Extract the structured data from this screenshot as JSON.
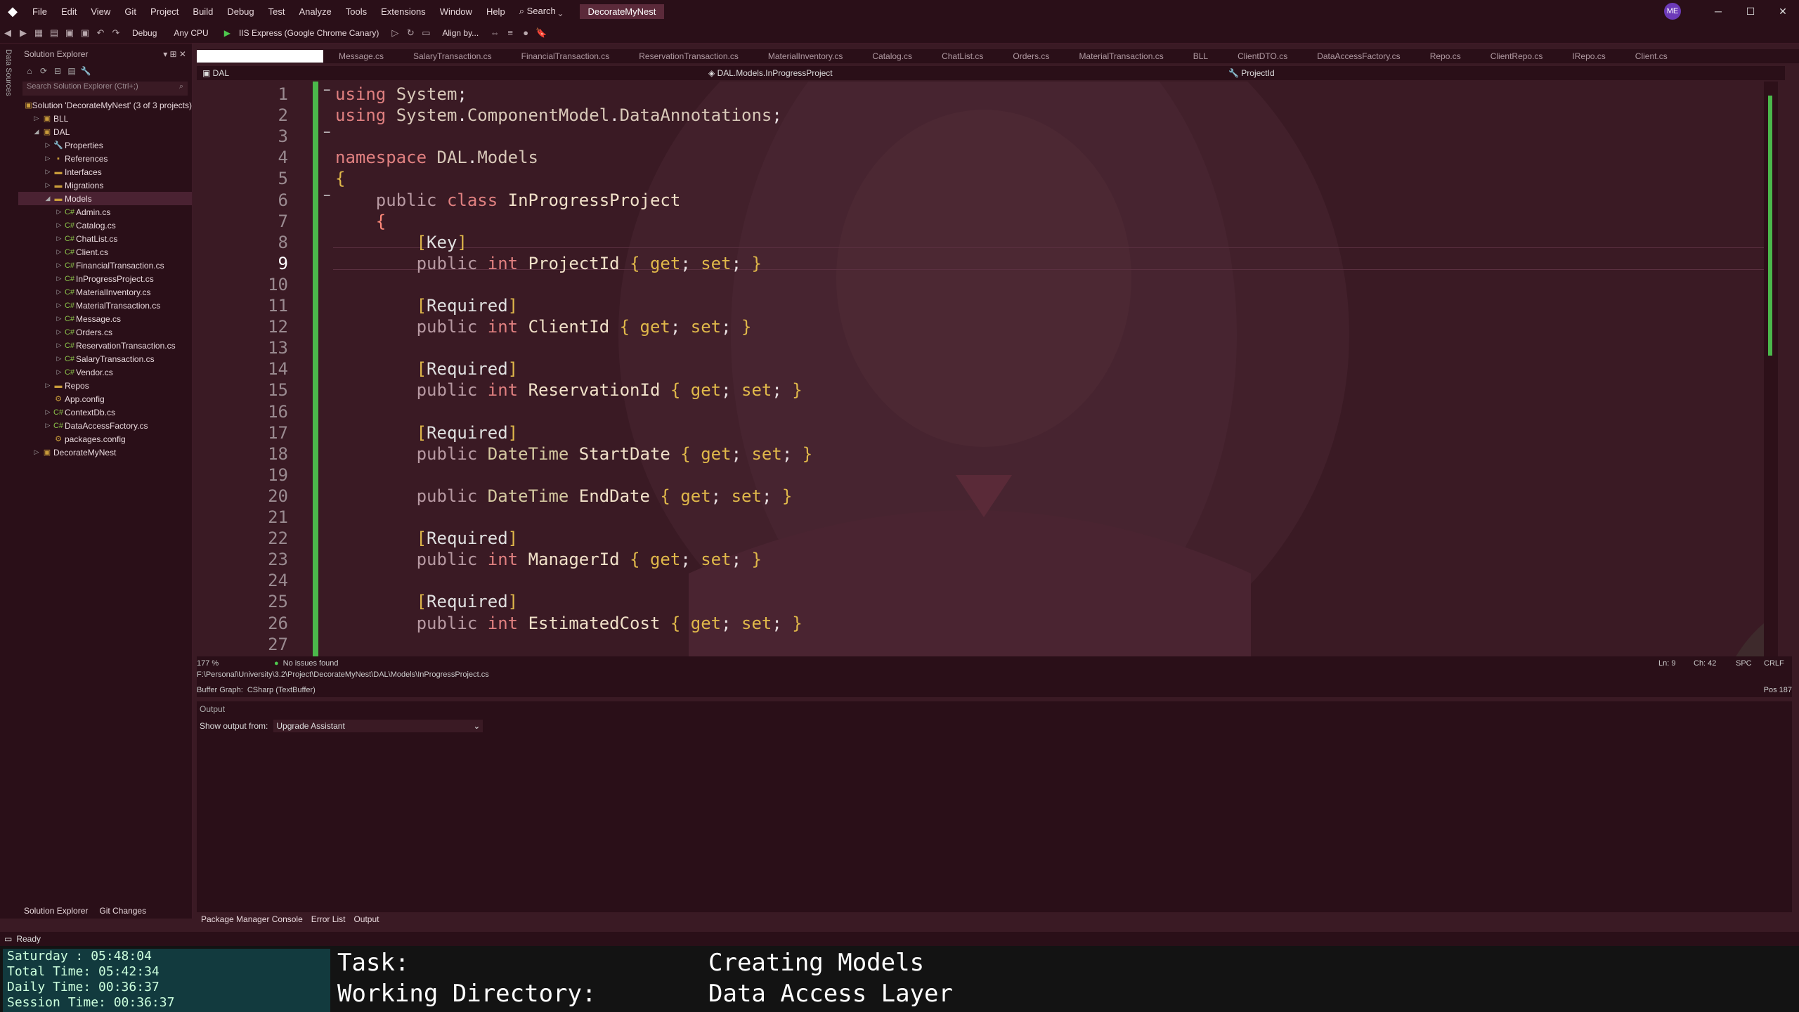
{
  "titlebar": {
    "menu": [
      "File",
      "Edit",
      "View",
      "Git",
      "Project",
      "Build",
      "Debug",
      "Test",
      "Analyze",
      "Tools",
      "Extensions",
      "Window",
      "Help"
    ],
    "search_label": "Search",
    "solution_name": "DecorateMyNest",
    "user_initials": "ME",
    "minimize": "─",
    "maximize": "☐",
    "close": "✕"
  },
  "toolbar": {
    "config": "Debug",
    "platform": "Any CPU",
    "run_target": "IIS Express (Google Chrome Canary)",
    "align_label": "Align by..."
  },
  "left_strip": {
    "label": "Data Sources"
  },
  "solution_explorer": {
    "title": "Solution Explorer",
    "search_placeholder": "Search Solution Explorer (Ctrl+;)",
    "items": [
      {
        "label": "Solution 'DecorateMyNest' (3 of 3 projects)",
        "indent": 0,
        "expander": "",
        "icon": "solution-icon",
        "glyph": "▣",
        "cs": false,
        "selected": false
      },
      {
        "label": "BLL",
        "indent": 1,
        "expander": "▷",
        "icon": "project-icon",
        "glyph": "▣",
        "cs": false,
        "selected": false
      },
      {
        "label": "DAL",
        "indent": 1,
        "expander": "◢",
        "icon": "project-icon",
        "glyph": "▣",
        "cs": false,
        "selected": false
      },
      {
        "label": "Properties",
        "indent": 2,
        "expander": "▷",
        "icon": "wrench-icon",
        "glyph": "🔧",
        "cs": false,
        "selected": false
      },
      {
        "label": "References",
        "indent": 2,
        "expander": "▷",
        "icon": "references-icon",
        "glyph": "▪",
        "cs": false,
        "selected": false
      },
      {
        "label": "Interfaces",
        "indent": 2,
        "expander": "▷",
        "icon": "folder-icon",
        "glyph": "▬",
        "cs": false,
        "selected": false
      },
      {
        "label": "Migrations",
        "indent": 2,
        "expander": "▷",
        "icon": "folder-icon",
        "glyph": "▬",
        "cs": false,
        "selected": false
      },
      {
        "label": "Models",
        "indent": 2,
        "expander": "◢",
        "icon": "folder-open-icon",
        "glyph": "▬",
        "cs": false,
        "selected": true
      },
      {
        "label": "Admin.cs",
        "indent": 3,
        "expander": "▷",
        "icon": "csharp-file-icon",
        "glyph": "C#",
        "cs": true,
        "selected": false
      },
      {
        "label": "Catalog.cs",
        "indent": 3,
        "expander": "▷",
        "icon": "csharp-file-icon",
        "glyph": "C#",
        "cs": true,
        "selected": false
      },
      {
        "label": "ChatList.cs",
        "indent": 3,
        "expander": "▷",
        "icon": "csharp-file-icon",
        "glyph": "C#",
        "cs": true,
        "selected": false
      },
      {
        "label": "Client.cs",
        "indent": 3,
        "expander": "▷",
        "icon": "csharp-file-icon",
        "glyph": "C#",
        "cs": true,
        "selected": false
      },
      {
        "label": "FinancialTransaction.cs",
        "indent": 3,
        "expander": "▷",
        "icon": "csharp-file-icon",
        "glyph": "C#",
        "cs": true,
        "selected": false
      },
      {
        "label": "InProgressProject.cs",
        "indent": 3,
        "expander": "▷",
        "icon": "csharp-file-icon",
        "glyph": "C#",
        "cs": true,
        "selected": false
      },
      {
        "label": "MaterialInventory.cs",
        "indent": 3,
        "expander": "▷",
        "icon": "csharp-file-icon",
        "glyph": "C#",
        "cs": true,
        "selected": false
      },
      {
        "label": "MaterialTransaction.cs",
        "indent": 3,
        "expander": "▷",
        "icon": "csharp-file-icon",
        "glyph": "C#",
        "cs": true,
        "selected": false
      },
      {
        "label": "Message.cs",
        "indent": 3,
        "expander": "▷",
        "icon": "csharp-file-icon",
        "glyph": "C#",
        "cs": true,
        "selected": false
      },
      {
        "label": "Orders.cs",
        "indent": 3,
        "expander": "▷",
        "icon": "csharp-file-icon",
        "glyph": "C#",
        "cs": true,
        "selected": false
      },
      {
        "label": "ReservationTransaction.cs",
        "indent": 3,
        "expander": "▷",
        "icon": "csharp-file-icon",
        "glyph": "C#",
        "cs": true,
        "selected": false
      },
      {
        "label": "SalaryTransaction.cs",
        "indent": 3,
        "expander": "▷",
        "icon": "csharp-file-icon",
        "glyph": "C#",
        "cs": true,
        "selected": false
      },
      {
        "label": "Vendor.cs",
        "indent": 3,
        "expander": "▷",
        "icon": "csharp-file-icon",
        "glyph": "C#",
        "cs": true,
        "selected": false
      },
      {
        "label": "Repos",
        "indent": 2,
        "expander": "▷",
        "icon": "folder-icon",
        "glyph": "▬",
        "cs": false,
        "selected": false
      },
      {
        "label": "App.config",
        "indent": 2,
        "expander": "",
        "icon": "config-file-icon",
        "glyph": "⚙",
        "cs": false,
        "selected": false
      },
      {
        "label": "ContextDb.cs",
        "indent": 2,
        "expander": "▷",
        "icon": "csharp-file-icon",
        "glyph": "C#",
        "cs": true,
        "selected": false
      },
      {
        "label": "DataAccessFactory.cs",
        "indent": 2,
        "expander": "▷",
        "icon": "csharp-file-icon",
        "glyph": "C#",
        "cs": true,
        "selected": false
      },
      {
        "label": "packages.config",
        "indent": 2,
        "expander": "",
        "icon": "config-file-icon",
        "glyph": "⚙",
        "cs": false,
        "selected": false
      },
      {
        "label": "DecorateMyNest",
        "indent": 1,
        "expander": "▷",
        "icon": "web-project-icon",
        "glyph": "▣",
        "cs": false,
        "selected": false
      }
    ],
    "bottom_tabs": [
      "Solution Explorer",
      "Git Changes"
    ]
  },
  "editor_tabs": [
    "Message.cs",
    "SalaryTransaction.cs",
    "FinancialTransaction.cs",
    "ReservationTransaction.cs",
    "MaterialInventory.cs",
    "Catalog.cs",
    "ChatList.cs",
    "Orders.cs",
    "MaterialTransaction.cs",
    "BLL",
    "ClientDTO.cs",
    "DataAccessFactory.cs",
    "Repo.cs",
    "ClientRepo.cs",
    "IRepo.cs",
    "Client.cs"
  ],
  "navbar": {
    "project": "DAL",
    "class": "DAL.Models.InProgressProject",
    "member": "ProjectId"
  },
  "code_lines": [
    {
      "n": "1",
      "html": "<span class='kw'>using</span> <span class='ns'>System</span>;"
    },
    {
      "n": "2",
      "html": "<span class='kw'>using</span> <span class='ns'>System</span>.<span class='ns'>ComponentModel</span>.<span class='ns'>DataAnnotations</span>;"
    },
    {
      "n": "3",
      "html": ""
    },
    {
      "n": "4",
      "html": "<span class='kw'>namespace</span> <span class='ns'>DAL</span>.<span class='ns'>Models</span>"
    },
    {
      "n": "5",
      "html": "<span class='br'>{</span>"
    },
    {
      "n": "6",
      "html": "    <span class='dim'>public</span> <span class='kw'>class</span> <span class='name'>InProgressProject</span>"
    },
    {
      "n": "7",
      "html": "    <span class='kw2'>{</span>"
    },
    {
      "n": "8",
      "html": "        <span class='br'>[</span><span class='attr'>Key</span><span class='br'>]</span>"
    },
    {
      "n": "9",
      "html": "        <span class='dim'>public</span> <span class='kw'>int</span> <span class='name'>ProjectId</span> <span class='br'>{</span> <span class='br'>get</span>; <span class='br'>set</span>; <span class='br'>}</span>"
    },
    {
      "n": "10",
      "html": ""
    },
    {
      "n": "11",
      "html": "        <span class='br'>[</span><span class='attr'>Required</span><span class='br'>]</span>"
    },
    {
      "n": "12",
      "html": "        <span class='dim'>public</span> <span class='kw'>int</span> <span class='name'>ClientId</span> <span class='br'>{</span> <span class='br'>get</span>; <span class='br'>set</span>; <span class='br'>}</span>"
    },
    {
      "n": "13",
      "html": ""
    },
    {
      "n": "14",
      "html": "        <span class='br'>[</span><span class='attr'>Required</span><span class='br'>]</span>"
    },
    {
      "n": "15",
      "html": "        <span class='dim'>public</span> <span class='kw'>int</span> <span class='name'>ReservationId</span> <span class='br'>{</span> <span class='br'>get</span>; <span class='br'>set</span>; <span class='br'>}</span>"
    },
    {
      "n": "16",
      "html": ""
    },
    {
      "n": "17",
      "html": "        <span class='br'>[</span><span class='attr'>Required</span><span class='br'>]</span>"
    },
    {
      "n": "18",
      "html": "        <span class='dim'>public</span> <span class='ty'>DateTime</span> <span class='name'>StartDate</span> <span class='br'>{</span> <span class='br'>get</span>; <span class='br'>set</span>; <span class='br'>}</span>"
    },
    {
      "n": "19",
      "html": ""
    },
    {
      "n": "20",
      "html": "        <span class='dim'>public</span> <span class='ty'>DateTime</span> <span class='name'>EndDate</span> <span class='br'>{</span> <span class='br'>get</span>; <span class='br'>set</span>; <span class='br'>}</span>"
    },
    {
      "n": "21",
      "html": ""
    },
    {
      "n": "22",
      "html": "        <span class='br'>[</span><span class='attr'>Required</span><span class='br'>]</span>"
    },
    {
      "n": "23",
      "html": "        <span class='dim'>public</span> <span class='kw'>int</span> <span class='name'>ManagerId</span> <span class='br'>{</span> <span class='br'>get</span>; <span class='br'>set</span>; <span class='br'>}</span>"
    },
    {
      "n": "24",
      "html": ""
    },
    {
      "n": "25",
      "html": "        <span class='br'>[</span><span class='attr'>Required</span><span class='br'>]</span>"
    },
    {
      "n": "26",
      "html": "        <span class='dim'>public</span> <span class='kw'>int</span> <span class='name'>EstimatedCost</span> <span class='br'>{</span> <span class='br'>get</span>; <span class='br'>set</span>; <span class='br'>}</span>"
    },
    {
      "n": "27",
      "html": ""
    }
  ],
  "current_line": "9",
  "editor_status": {
    "zoom": "177 %",
    "issues": "No issues found",
    "ln": "Ln: 9",
    "ch": "Ch: 42",
    "spc": "SPC",
    "crlf": "CRLF"
  },
  "file_path": "F:\\Personal\\University\\3.2\\Project\\DecorateMyNest\\DAL\\Models\\InProgressProject.cs",
  "buffer_graph": {
    "label": "Buffer Graph:",
    "value": "CSharp (TextBuffer)",
    "pos": "Pos 187"
  },
  "output": {
    "title": "Output",
    "from_label": "Show output from:",
    "from_value": "Upgrade Assistant"
  },
  "bottom_tabs": [
    "Package Manager Console",
    "Error List",
    "Output"
  ],
  "status": {
    "text": "Ready"
  },
  "overlay": {
    "timers": [
      "Saturday  :  05:48:04",
      "Total Time: 05:42:34",
      "Daily Time: 00:36:37",
      "Session Time: 00:36:37"
    ],
    "task_label": "Task:",
    "task_value": "Creating Models",
    "dir_label": "Working Directory:",
    "dir_value": "Data Access Layer"
  }
}
